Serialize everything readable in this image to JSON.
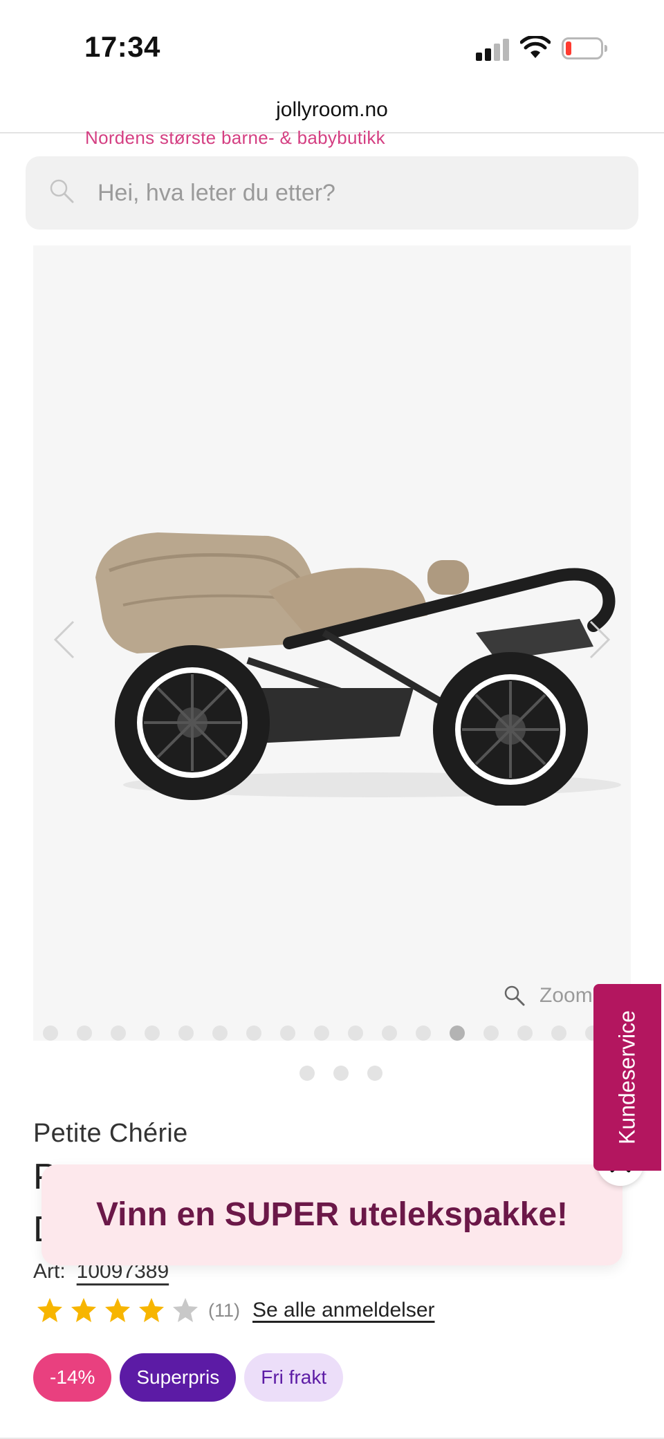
{
  "status_bar": {
    "time": "17:34",
    "icons": [
      "signal-icon",
      "wifi-icon",
      "battery-low-icon"
    ],
    "battery_color": "#ff3b30"
  },
  "browser": {
    "url": "jollyroom.no"
  },
  "header": {
    "tagline": "Nordens største barne- & babybutikk"
  },
  "search": {
    "placeholder": "Hei, hva leter du etter?",
    "icon": "search-icon"
  },
  "gallery": {
    "zoom_label": "Zoom",
    "total_images": 17,
    "active_index": 12,
    "secondary_dots": 3,
    "image_alt": "Petite Chérie stroller"
  },
  "product": {
    "brand": "Petite Chérie",
    "title_line1": "P",
    "title_line2": "D",
    "art_label": "Art:",
    "art_number": "10097389",
    "rating": 4,
    "rating_max": 5,
    "review_count": "(11)",
    "reviews_link": "Se alle anmeldelser"
  },
  "badges": [
    {
      "label": "-14%",
      "color": "#e9407f"
    },
    {
      "label": "Superpris",
      "color": "#5c1ba5"
    },
    {
      "label": "Fri frakt",
      "color": "#ecdef9"
    }
  ],
  "promo": {
    "text": "Vinn en SUPER utelekspakke!",
    "close_icon": "close-icon"
  },
  "service_tab": {
    "label": "Kundeservice",
    "color": "#b3165f"
  },
  "colors": {
    "brand_pink": "#d43f82",
    "star": "#f7b500",
    "star_empty": "#c8c8c8"
  }
}
